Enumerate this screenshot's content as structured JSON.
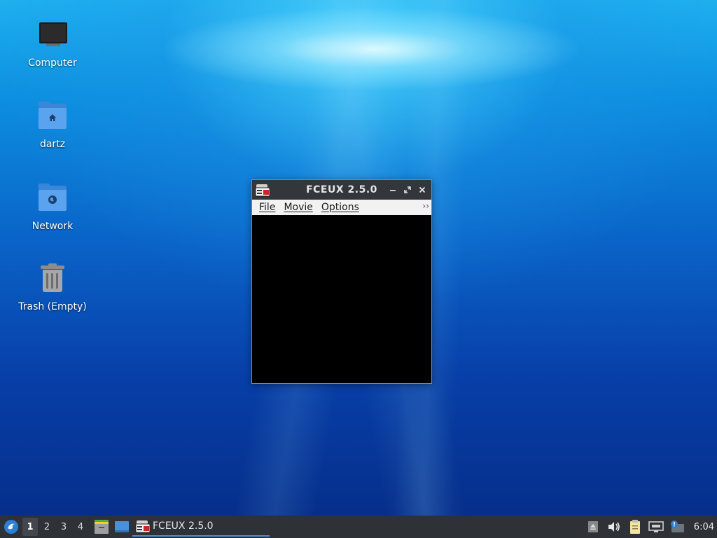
{
  "desktop": {
    "icons": [
      {
        "label": "Computer",
        "icon": "computer-icon"
      },
      {
        "label": "dartz",
        "icon": "home-folder-icon"
      },
      {
        "label": "Network",
        "icon": "network-folder-icon"
      },
      {
        "label": "Trash (Empty)",
        "icon": "trash-icon"
      }
    ]
  },
  "window": {
    "title": "FCEUX 2.5.0",
    "menu": [
      {
        "label": "File"
      },
      {
        "label": "Movie"
      },
      {
        "label": "Options"
      }
    ],
    "overflow": "››"
  },
  "taskbar": {
    "workspaces": [
      "1",
      "2",
      "3",
      "4"
    ],
    "active_workspace": "1",
    "task_label": "FCEUX 2.5.0",
    "clock": "6:04"
  },
  "colors": {
    "taskbar": "#2e3136",
    "titlebar": "#33363a",
    "accent": "#4a90d9"
  }
}
